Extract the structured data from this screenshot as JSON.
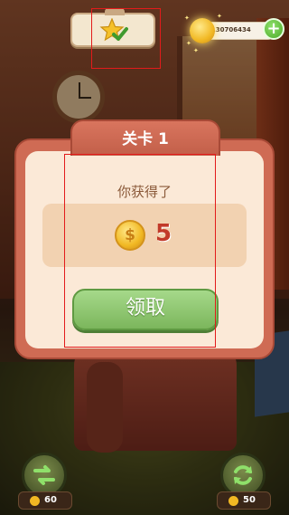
{
  "hud": {
    "coins": "2130706434",
    "plus_label": "+"
  },
  "dialog": {
    "title": "关卡 1",
    "subtitle": "你获得了",
    "reward_amount": "5",
    "coin_symbol": "$",
    "claim_label": "领取"
  },
  "bottom": {
    "left_cost": "60",
    "right_cost": "50"
  },
  "colors": {
    "header_red": "#c25f49",
    "panel_cream": "#fbe9d7",
    "claim_green": "#7cb65c",
    "reward_red": "#c23a2a",
    "annotation_red": "#e21b1b"
  },
  "icons": {
    "star": "star-icon",
    "check": "check-icon",
    "coin": "coin-icon",
    "swap": "swap-icon",
    "refresh": "refresh-icon",
    "plus": "plus-icon"
  }
}
